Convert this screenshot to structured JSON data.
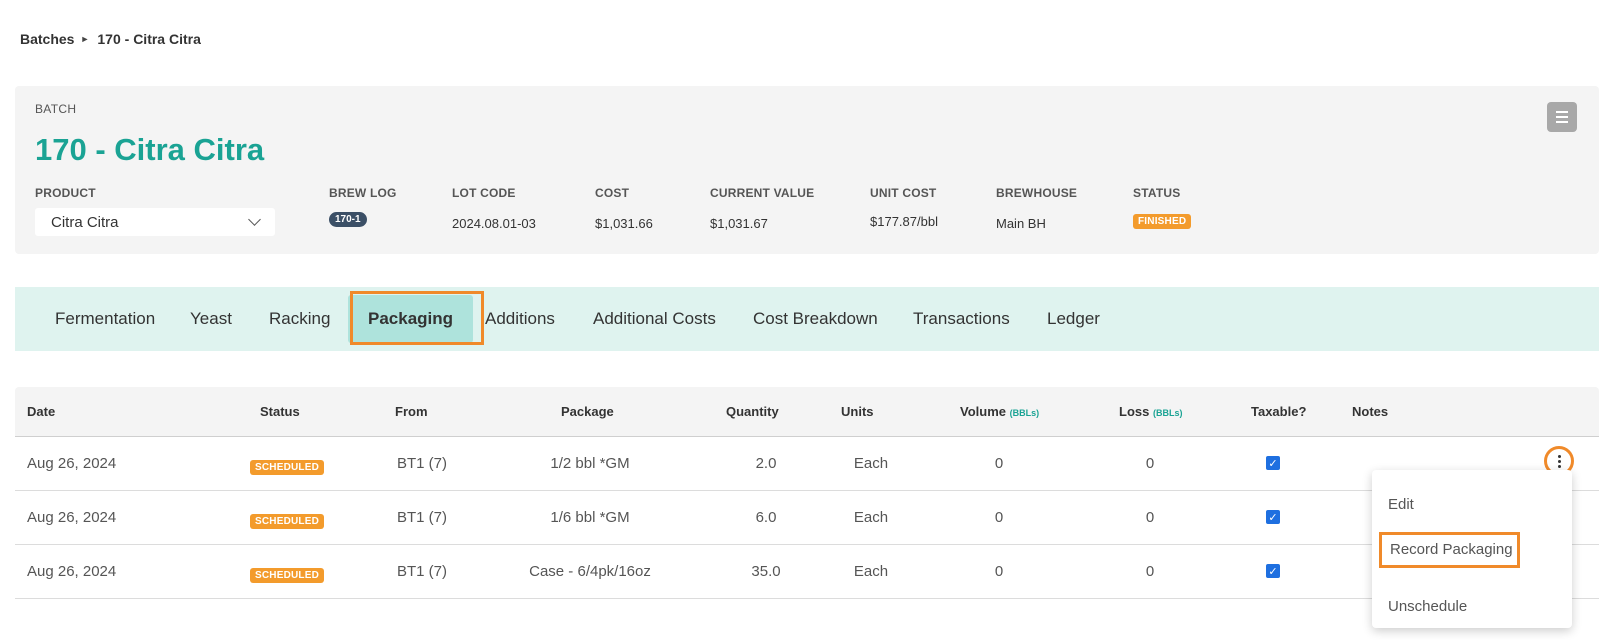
{
  "breadcrumb": {
    "root": "Batches",
    "current": "170 - Citra Citra"
  },
  "batch": {
    "label": "BATCH",
    "title": "170 - Citra Citra",
    "product_label": "PRODUCT",
    "product_value": "Citra Citra",
    "brew_log_label": "BREW LOG",
    "brew_log_value": "170-1",
    "lot_code_label": "LOT CODE",
    "lot_code_value": "2024.08.01-03",
    "cost_label": "COST",
    "cost_value": "$1,031.66",
    "current_value_label": "CURRENT VALUE",
    "current_value_value": "$1,031.67",
    "unit_cost_label": "UNIT COST",
    "unit_cost_value": "$177.87/bbl",
    "brewhouse_label": "BREWHOUSE",
    "brewhouse_value": "Main BH",
    "status_label": "STATUS",
    "status_value": "FINISHED"
  },
  "tabs": [
    "Fermentation",
    "Yeast",
    "Racking",
    "Packaging",
    "Additions",
    "Additional Costs",
    "Cost Breakdown",
    "Transactions",
    "Ledger"
  ],
  "active_tab": "Packaging",
  "table": {
    "headers": {
      "date": "Date",
      "status": "Status",
      "from": "From",
      "package": "Package",
      "quantity": "Quantity",
      "units": "Units",
      "volume": "Volume",
      "volume_unit": "(BBLs)",
      "loss": "Loss",
      "loss_unit": "(BBLs)",
      "taxable": "Taxable?",
      "notes": "Notes"
    },
    "rows": [
      {
        "date": "Aug 26, 2024",
        "status": "SCHEDULED",
        "from": "BT1 (7)",
        "package": "1/2 bbl *GM",
        "quantity": "2.0",
        "units": "Each",
        "volume": "0",
        "loss": "0",
        "taxable": "✓"
      },
      {
        "date": "Aug 26, 2024",
        "status": "SCHEDULED",
        "from": "BT1 (7)",
        "package": "1/6 bbl *GM",
        "quantity": "6.0",
        "units": "Each",
        "volume": "0",
        "loss": "0",
        "taxable": "✓"
      },
      {
        "date": "Aug 26, 2024",
        "status": "SCHEDULED",
        "from": "BT1 (7)",
        "package": "Case - 6/4pk/16oz",
        "quantity": "35.0",
        "units": "Each",
        "volume": "0",
        "loss": "0",
        "taxable": "✓"
      }
    ]
  },
  "row_menu": {
    "edit": "Edit",
    "record": "Record Packaging",
    "unschedule": "Unschedule"
  },
  "colors": {
    "accent": "#1aa394",
    "highlight": "#f08a2a",
    "badge": "#f39b2c"
  }
}
